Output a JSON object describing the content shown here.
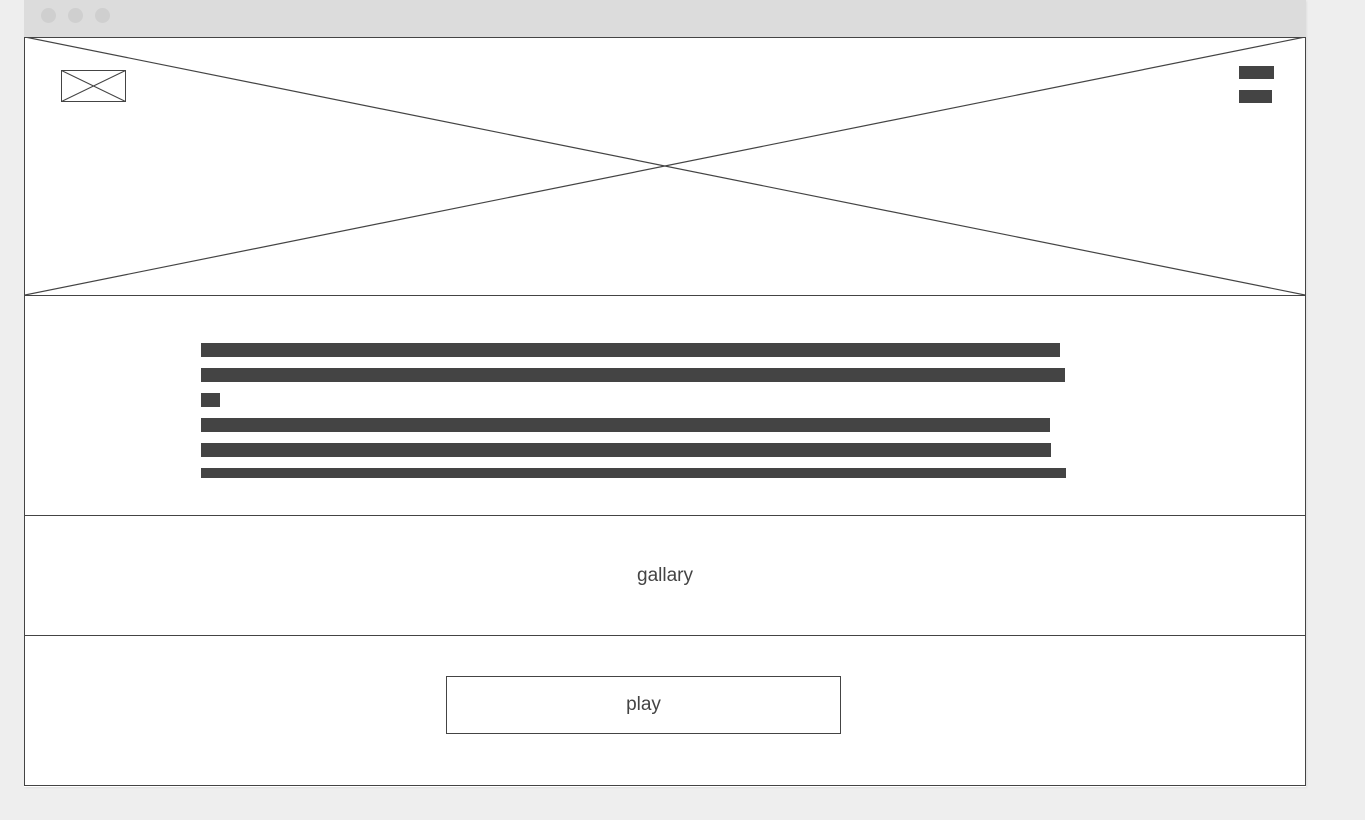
{
  "gallery": {
    "label": "gallary"
  },
  "play": {
    "label": "play"
  },
  "colors": {
    "ink": "#444444",
    "titlebar": "#dcdcdc",
    "window_dots": "#cfcfcf",
    "page_background": "#eeeeee",
    "window_background": "#ffffff"
  },
  "icons": {
    "hero": "image-placeholder-icon",
    "logo": "logo-placeholder-icon",
    "menu": "menu-icon"
  }
}
